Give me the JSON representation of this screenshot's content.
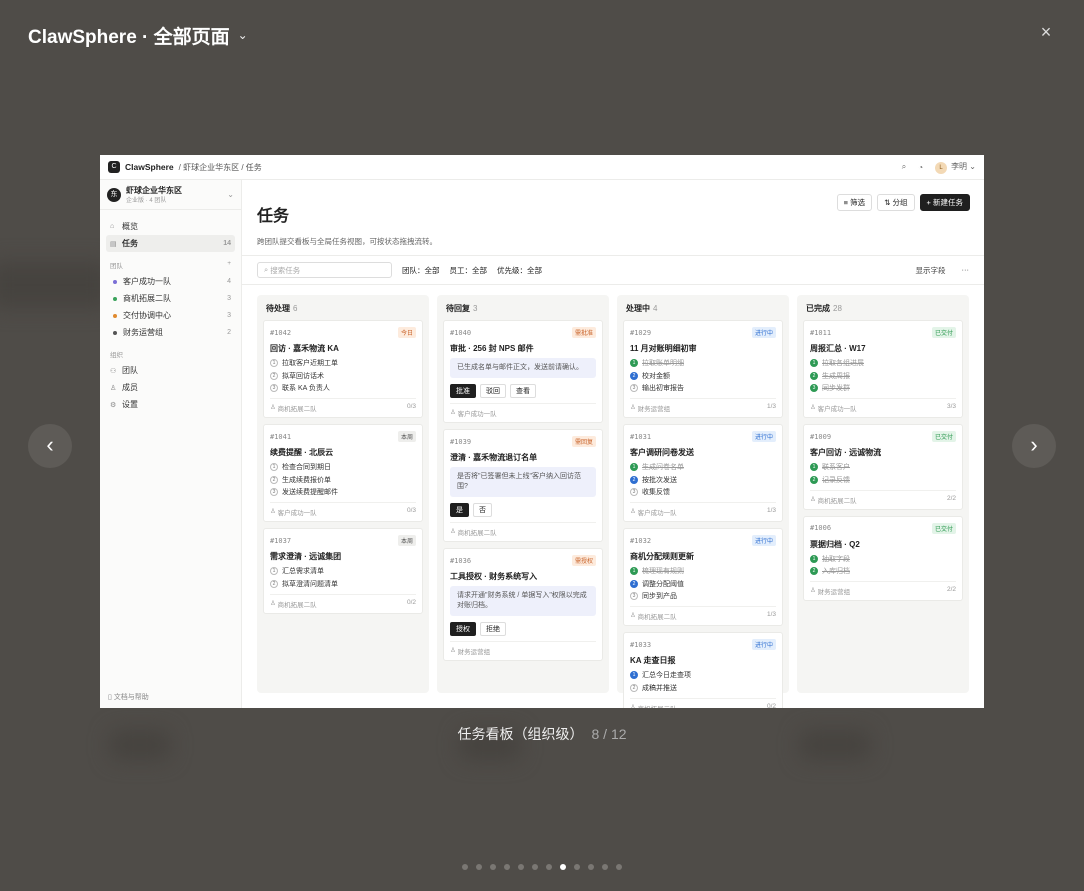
{
  "viewer": {
    "title": "ClawSphere · 全部页面",
    "close_icon": "×",
    "prev_icon": "‹",
    "next_icon": "›",
    "caption": "任务看板（组织级）",
    "counter": "8 / 12",
    "dots_total": 12,
    "dots_active": 8
  },
  "app": {
    "brand": "ClawSphere",
    "logo": "C",
    "breadcrumb": "/ 虾球企业华东区 / 任务",
    "user_initial": "L",
    "user_name": "李明",
    "org_initial": "东",
    "org_name": "虾球企业华东区",
    "org_sub": "企业版 · 4 团队",
    "nav": [
      {
        "label": "概览",
        "count": ""
      },
      {
        "label": "任务",
        "count": "14"
      }
    ],
    "teams_section": "团队",
    "teams": [
      {
        "label": "客户成功一队",
        "count": "4",
        "color": "#7b6fd6"
      },
      {
        "label": "商机拓展二队",
        "count": "3",
        "color": "#3aa35b"
      },
      {
        "label": "交付协调中心",
        "count": "3",
        "color": "#e08a2e"
      },
      {
        "label": "财务运营组",
        "count": "2",
        "color": "#555555"
      }
    ],
    "org_section": "组织",
    "org_nav": [
      {
        "label": "团队"
      },
      {
        "label": "成员"
      },
      {
        "label": "设置"
      }
    ],
    "help": "文档与帮助",
    "page_title": "任务",
    "page_desc": "跨团队提交看板与全局任务视图，可按状态拖拽流转。",
    "actions": {
      "filter": "筛选",
      "group": "分组",
      "new": "+ 新建任务"
    },
    "search_placeholder": "搜索任务",
    "filters": {
      "team": "团队：全部",
      "staff": "员工：全部",
      "priority": "优先级：全部"
    },
    "show_fields": "显示字段",
    "more": "···"
  },
  "columns": [
    {
      "title": "待处理",
      "count": "6",
      "cards": [
        {
          "id": "#1042",
          "tag": "今日",
          "tag_style": "orange",
          "title": "回访 · 嘉禾物流 KA",
          "steps": [
            {
              "n": "1",
              "t": "拉取客户近期工单",
              "s": "todo"
            },
            {
              "n": "2",
              "t": "拟草回访话术",
              "s": "todo"
            },
            {
              "n": "3",
              "t": "联系 KA 负责人",
              "s": "todo"
            }
          ],
          "team": "商机拓展二队",
          "progress": "0/3"
        },
        {
          "id": "#1041",
          "tag": "本周",
          "tag_style": "gray",
          "title": "续费提醒 · 北辰云",
          "steps": [
            {
              "n": "1",
              "t": "检查合同到期日",
              "s": "todo"
            },
            {
              "n": "2",
              "t": "生成续费报价单",
              "s": "todo"
            },
            {
              "n": "3",
              "t": "发送续费提醒邮件",
              "s": "todo"
            }
          ],
          "team": "客户成功一队",
          "progress": "0/3"
        },
        {
          "id": "#1037",
          "tag": "本周",
          "tag_style": "gray",
          "title": "需求澄清 · 远诚集团",
          "steps": [
            {
              "n": "1",
              "t": "汇总需求清单",
              "s": "todo"
            },
            {
              "n": "2",
              "t": "拟草澄清问题清单",
              "s": "todo"
            }
          ],
          "team": "商机拓展二队",
          "progress": "0/2"
        }
      ]
    },
    {
      "title": "待回复",
      "count": "3",
      "cards": [
        {
          "id": "#1040",
          "tag": "需批准",
          "tag_style": "orange",
          "title": "审批 · 256 封 NPS 邮件",
          "note": "已生成名单与邮件正文，发送前请确认。",
          "buttons": [
            "批准",
            "驳回",
            "查看"
          ],
          "team": "客户成功一队"
        },
        {
          "id": "#1039",
          "tag": "需回复",
          "tag_style": "orange",
          "title": "澄清 · 嘉禾物流退订名单",
          "note": "是否将\"已签署但未上线\"客户纳入回访范围?",
          "buttons": [
            "是",
            "否"
          ],
          "team": "商机拓展二队"
        },
        {
          "id": "#1036",
          "tag": "需授权",
          "tag_style": "orange",
          "title": "工具授权 · 财务系统写入",
          "note": "请求开通\"财务系统 / 单据写入\"权限以完成对账归档。",
          "buttons": [
            "授权",
            "拒绝"
          ],
          "team": "财务运营组"
        }
      ]
    },
    {
      "title": "处理中",
      "count": "4",
      "cards": [
        {
          "id": "#1029",
          "tag": "进行中",
          "tag_style": "blue",
          "title": "11 月对账明细初审",
          "steps": [
            {
              "n": "1",
              "t": "拉取账单明细",
              "s": "done"
            },
            {
              "n": "2",
              "t": "校对金额",
              "s": "cur"
            },
            {
              "n": "3",
              "t": "输出初审报告",
              "s": "todo"
            }
          ],
          "team": "财务运营组",
          "progress": "1/3"
        },
        {
          "id": "#1031",
          "tag": "进行中",
          "tag_style": "blue",
          "title": "客户调研问卷发送",
          "steps": [
            {
              "n": "1",
              "t": "生成问卷名单",
              "s": "done"
            },
            {
              "n": "2",
              "t": "按批次发送",
              "s": "cur"
            },
            {
              "n": "3",
              "t": "收集反馈",
              "s": "todo"
            }
          ],
          "team": "客户成功一队",
          "progress": "1/3"
        },
        {
          "id": "#1032",
          "tag": "进行中",
          "tag_style": "blue",
          "title": "商机分配规则更新",
          "steps": [
            {
              "n": "1",
              "t": "梳理现有规则",
              "s": "done"
            },
            {
              "n": "2",
              "t": "调整分配阈值",
              "s": "cur"
            },
            {
              "n": "3",
              "t": "同步到产品",
              "s": "todo"
            }
          ],
          "team": "商机拓展二队",
          "progress": "1/3"
        },
        {
          "id": "#1033",
          "tag": "进行中",
          "tag_style": "blue",
          "title": "KA 走查日报",
          "steps": [
            {
              "n": "1",
              "t": "汇总今日走查项",
              "s": "cur"
            },
            {
              "n": "2",
              "t": "成稿并推送",
              "s": "todo"
            }
          ],
          "team": "商机拓展二队",
          "progress": "0/2"
        }
      ]
    },
    {
      "title": "已完成",
      "count": "28",
      "cards": [
        {
          "id": "#1011",
          "tag": "已交付",
          "tag_style": "green",
          "title": "周报汇总 · W17",
          "steps": [
            {
              "n": "1",
              "t": "拉取各组进展",
              "s": "done"
            },
            {
              "n": "2",
              "t": "生成周报",
              "s": "done"
            },
            {
              "n": "3",
              "t": "同步发群",
              "s": "done"
            }
          ],
          "team": "客户成功一队",
          "progress": "3/3"
        },
        {
          "id": "#1009",
          "tag": "已交付",
          "tag_style": "green",
          "title": "客户回访 · 远诚物流",
          "steps": [
            {
              "n": "1",
              "t": "联系客户",
              "s": "done"
            },
            {
              "n": "2",
              "t": "记录反馈",
              "s": "done"
            }
          ],
          "team": "商机拓展二队",
          "progress": "2/2"
        },
        {
          "id": "#1006",
          "tag": "已交付",
          "tag_style": "green",
          "title": "票据归档 · Q2",
          "steps": [
            {
              "n": "1",
              "t": "抽取字段",
              "s": "done"
            },
            {
              "n": "2",
              "t": "入库归档",
              "s": "done"
            }
          ],
          "team": "财务运营组",
          "progress": "2/2"
        }
      ]
    }
  ]
}
